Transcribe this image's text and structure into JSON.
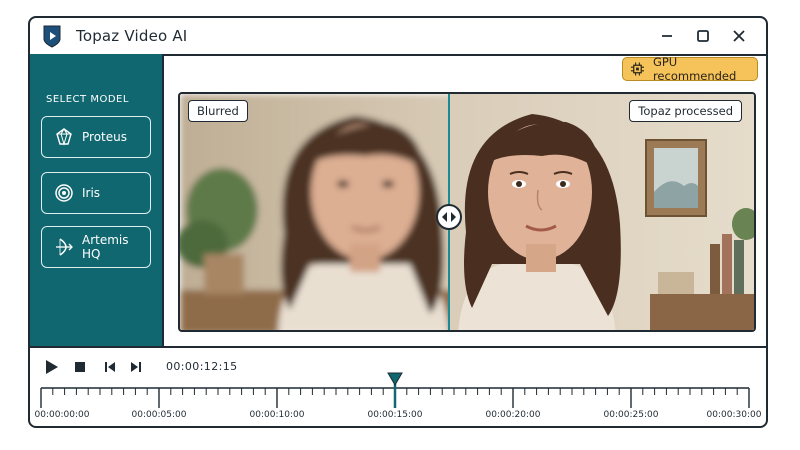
{
  "app": {
    "title": "Topaz Video AI",
    "window_controls": [
      "minimize-icon",
      "maximize-icon",
      "close-icon"
    ]
  },
  "badge": {
    "gpu_label": "GPU recommended",
    "icon": "chip-icon",
    "color": "#f6c25a"
  },
  "sidebar": {
    "header": "SELECT MODEL",
    "background": "#106770",
    "models": [
      {
        "label": "Proteus",
        "icon": "gem-icon"
      },
      {
        "label": "Iris",
        "icon": "target-icon"
      },
      {
        "label": "Artemis HQ",
        "icon": "bow-arrow-icon"
      }
    ]
  },
  "preview": {
    "left_label": "Blurred",
    "right_label": "Topaz processed",
    "split_position": 0.465,
    "handle_icon": "split-arrows-icon"
  },
  "playback": {
    "controls": [
      "play-icon",
      "stop-icon",
      "skip-back-icon",
      "skip-forward-icon"
    ],
    "current_time": "00:00:12:15",
    "playhead_fraction": 0.5,
    "timeline_labels": [
      "00:00:00:00",
      "00:00:05:00",
      "00:00:10:00",
      "00:00:15:00",
      "00:00:20:00",
      "00:00:25:00",
      "00:00:30:00"
    ]
  }
}
